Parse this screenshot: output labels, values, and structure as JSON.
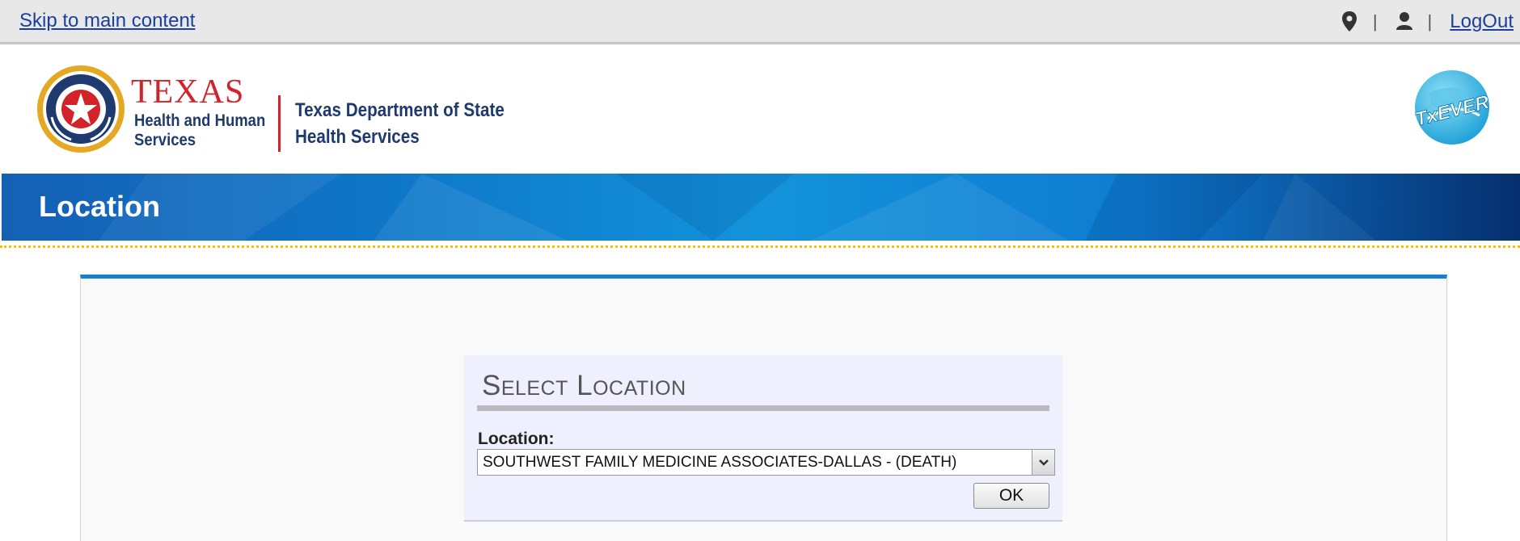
{
  "topbar": {
    "skip_link": "Skip to main content",
    "location_icon": "map-pin-icon",
    "user_icon": "user-icon",
    "separator": "|",
    "logout": "LogOut"
  },
  "header": {
    "hhs": {
      "texas": "TEXAS",
      "line1": "Health and Human",
      "line2": "Services"
    },
    "dshs": {
      "line1": "Texas Department of State",
      "line2": "Health Services"
    },
    "app_logo_icon": "txever-globe-icon",
    "brand_colors": {
      "red": "#d2232a",
      "navy": "#1e3a6e",
      "gold": "#e5a823"
    }
  },
  "band": {
    "title": "Location",
    "colors": {
      "start": "#1460b4",
      "end": "#062f6e",
      "dotted_rule": "#f5c400"
    }
  },
  "select_location": {
    "heading": "Select Location",
    "label": "Location:",
    "value": "SOUTHWEST FAMILY MEDICINE ASSOCIATES-DALLAS - (DEATH)",
    "dropdown_icon": "chevron-down-icon",
    "ok_label": "OK"
  }
}
